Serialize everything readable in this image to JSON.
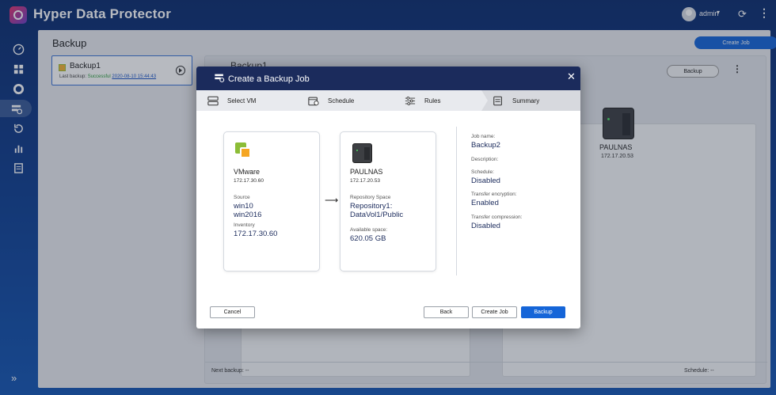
{
  "app": {
    "title": "Hyper Data Protector",
    "user": "admin"
  },
  "main": {
    "title": "Backup",
    "create_job_label": "Create Job",
    "job_card": {
      "name": "Backup1",
      "status_prefix": "Last backup: ",
      "status": "Successful",
      "date": "2020-08-10 15:44:43"
    },
    "detail": {
      "title": "Backup1",
      "backup_label": "Backup",
      "nas_name": "PAULNAS",
      "nas_ip": "172.17.20.53",
      "next_backup": "Next backup: --",
      "schedule": "Schedule: --"
    }
  },
  "modal": {
    "title": "Create a Backup Job",
    "steps": [
      {
        "label": "Select VM"
      },
      {
        "label": "Schedule"
      },
      {
        "label": "Rules"
      },
      {
        "label": "Summary"
      }
    ],
    "source": {
      "name": "VMware",
      "ip": "172.17.30.60",
      "source_label": "Source",
      "source_vm1": "win10",
      "source_vm2": "win2016",
      "inventory_label": "Inventory",
      "inventory_value": "172.17.30.60"
    },
    "destination": {
      "name": "PAULNAS",
      "ip": "172.17.20.53",
      "repo_label": "Repository Space",
      "repo_value1": "Repository1:",
      "repo_value2": "DataVol1/Public",
      "space_label": "Available space:",
      "space_value": "620.05 GB"
    },
    "summary": {
      "job_name_label": "Job name:",
      "job_name": "Backup2",
      "description_label": "Description:",
      "schedule_label": "Schedule:",
      "schedule": "Disabled",
      "encryption_label": "Transfer encryption:",
      "encryption": "Enabled",
      "compression_label": "Transfer compression:",
      "compression": "Disabled"
    },
    "buttons": {
      "cancel": "Cancel",
      "back": "Back",
      "create_job": "Create Job",
      "backup": "Backup"
    }
  },
  "colors": {
    "accent": "#1565d8",
    "header": "#1b2b5c",
    "success": "#2a9d3a"
  }
}
